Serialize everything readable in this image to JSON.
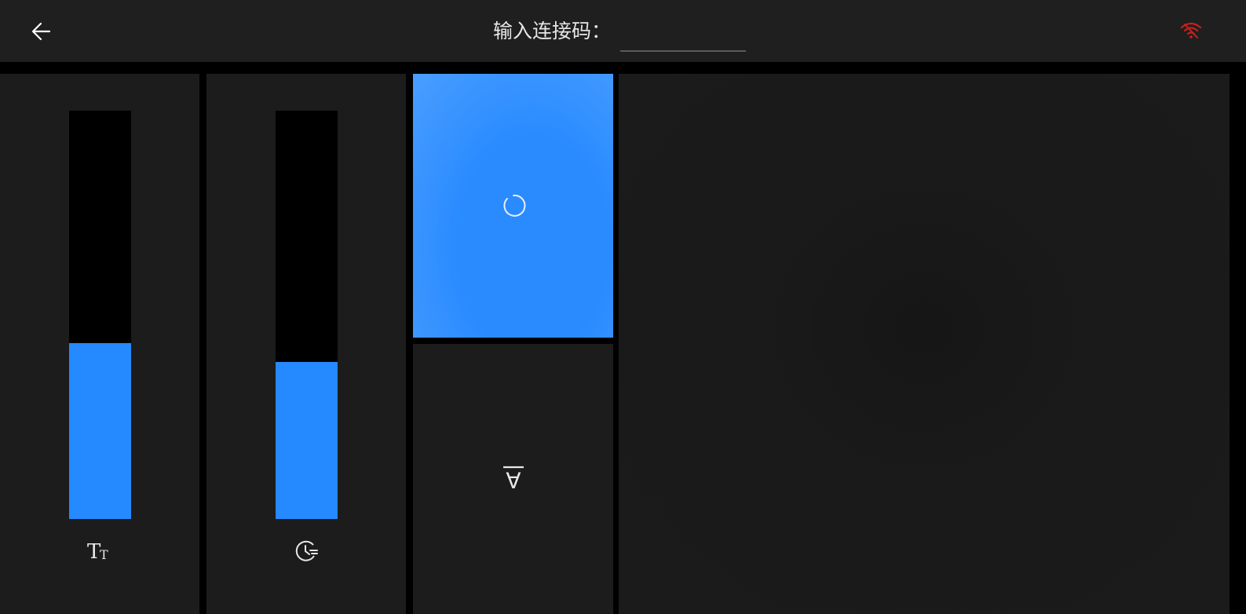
{
  "header": {
    "back_icon": "arrow-left-icon",
    "connect_label": "输入连接码：",
    "connect_value": "",
    "wifi_icon": "wifi-disconnected-icon",
    "wifi_color": "#d42020"
  },
  "sliders": [
    {
      "icon": "text-size-icon",
      "level": 0.43
    },
    {
      "icon": "timer-icon",
      "level": 0.385
    }
  ],
  "tiles": [
    {
      "icon": "loading-spinner-icon",
      "active": true,
      "color": "#2a8bff"
    },
    {
      "icon": "for-all-symbol-icon",
      "glyph": "∀",
      "active": false
    }
  ],
  "colors": {
    "accent": "#2589ff",
    "topbar": "#1f1f1f",
    "panel": "#1c1c1c",
    "background": "#000000"
  }
}
